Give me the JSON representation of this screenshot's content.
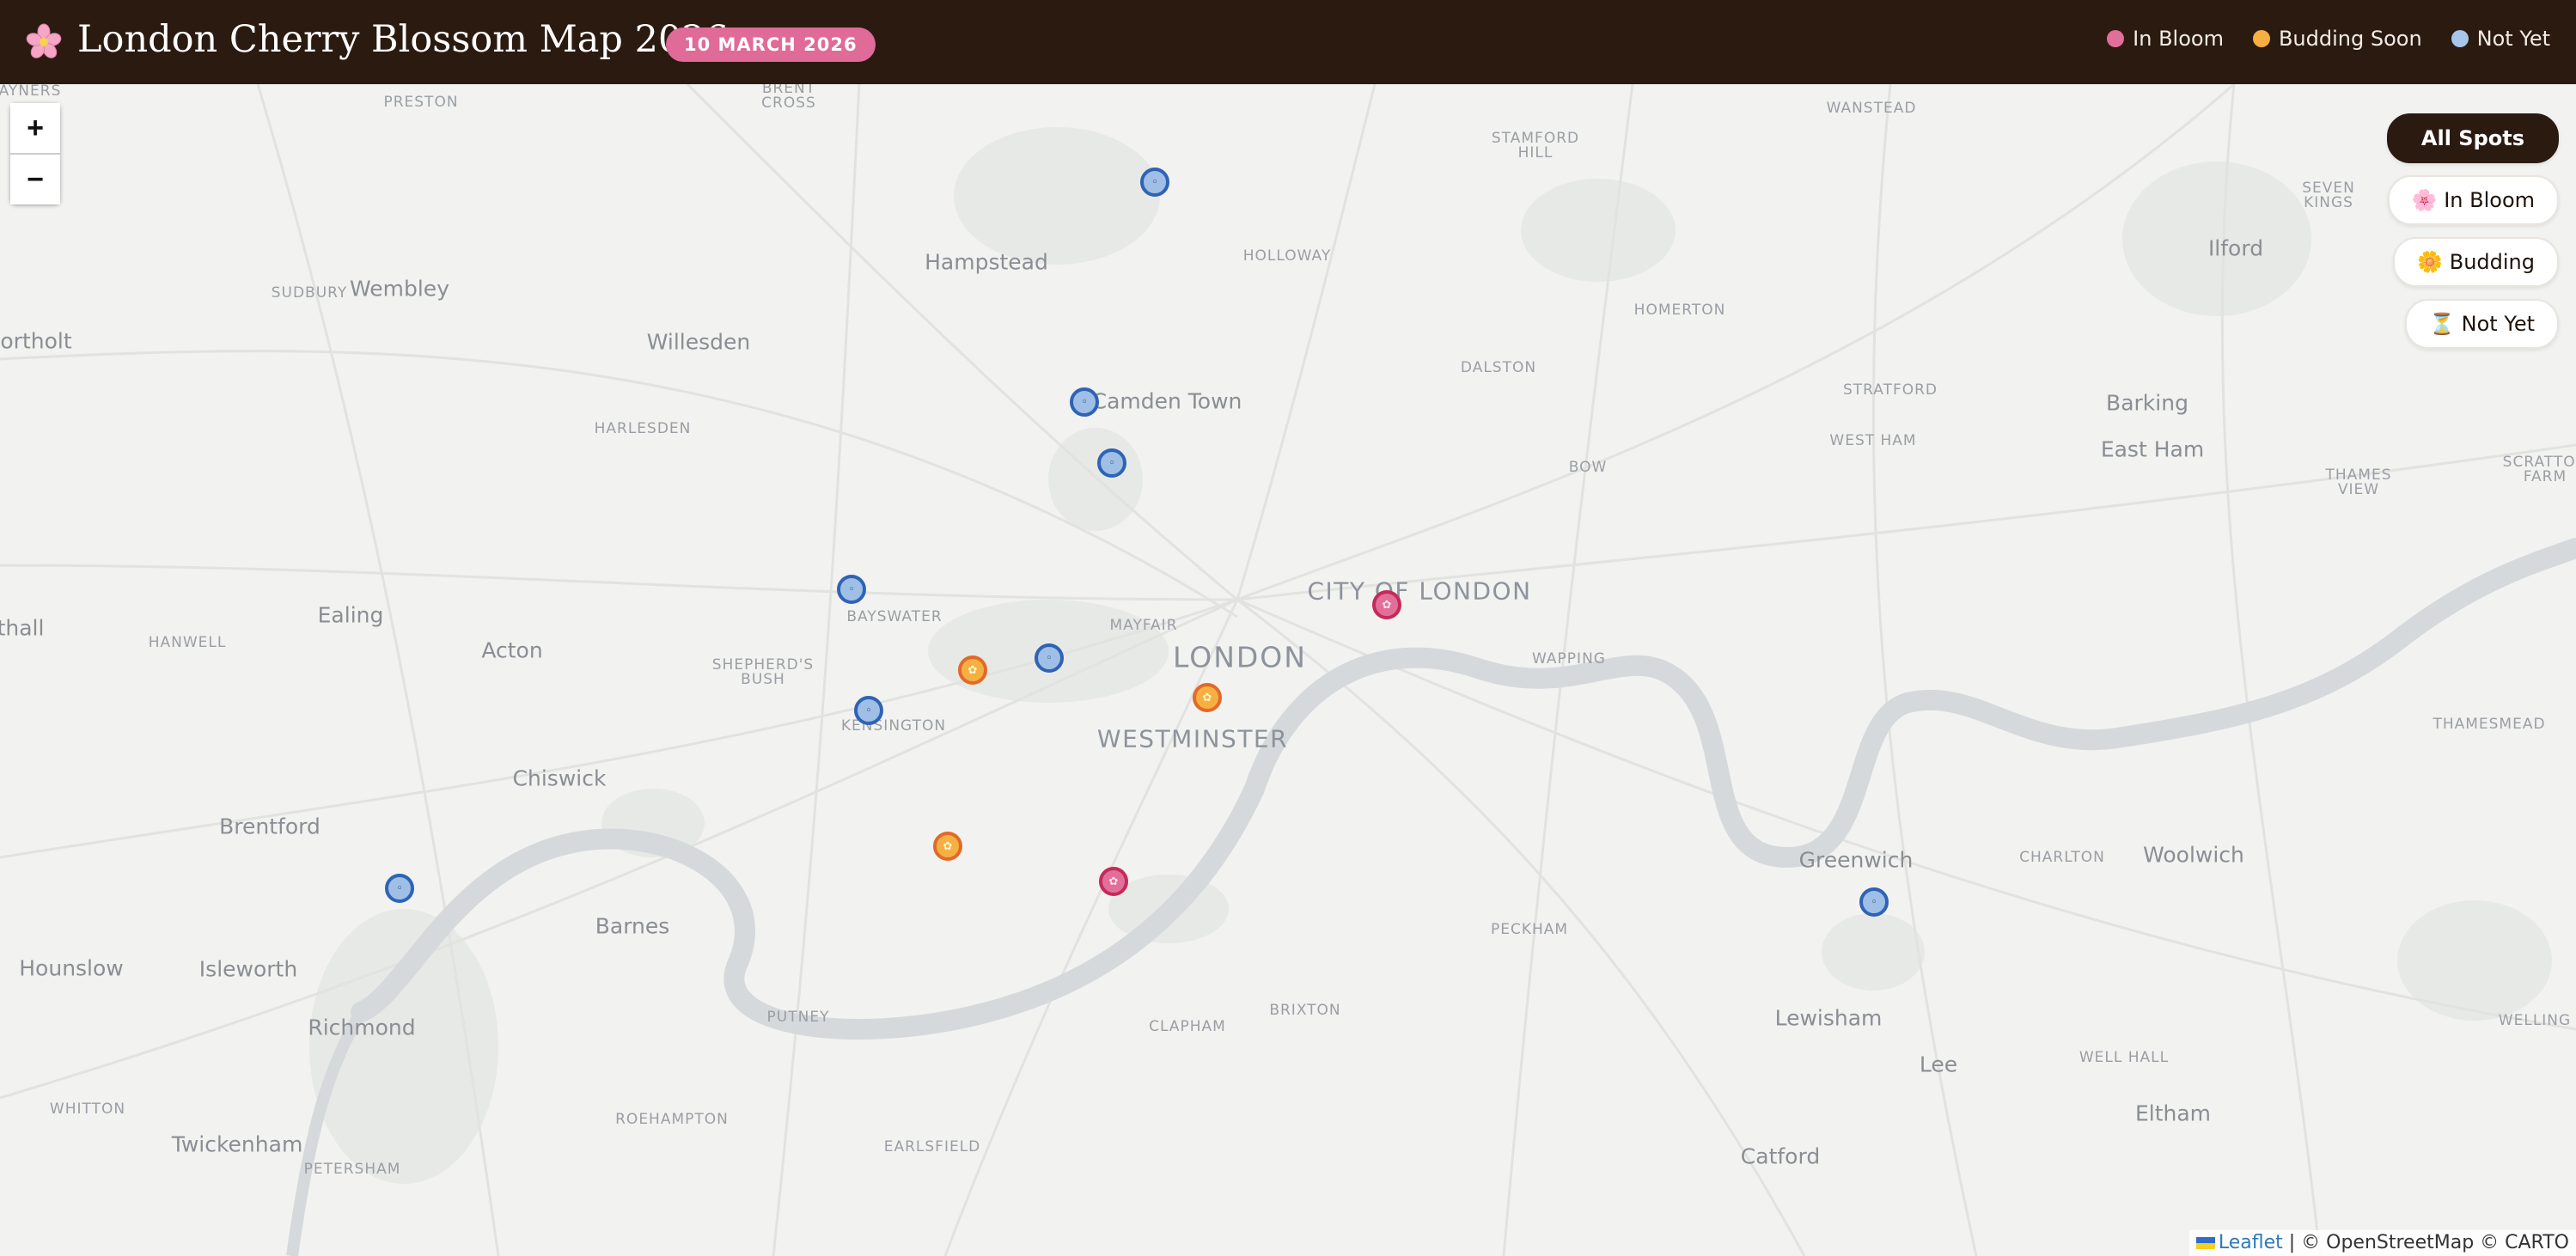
{
  "header": {
    "title": "London Cherry Blossom Map 2026",
    "icon": "cherry-blossom-icon",
    "date_badge": "10 MARCH 2026",
    "legend": [
      {
        "label": "In Bloom",
        "color": "#e16f99"
      },
      {
        "label": "Budding Soon",
        "color": "#f6b042"
      },
      {
        "label": "Not Yet",
        "color": "#a8c6ea"
      }
    ]
  },
  "zoom": {
    "in": "+",
    "out": "−"
  },
  "filters": [
    {
      "label": "All Spots",
      "icon": "",
      "active": true
    },
    {
      "label": "In Bloom",
      "icon": "🌸",
      "active": false
    },
    {
      "label": "Budding",
      "icon": "🌼",
      "active": false
    },
    {
      "label": "Not Yet",
      "icon": "⏳",
      "active": false
    }
  ],
  "places": {
    "preston": "PRESTON",
    "brent_cross": "BRENT\nCROSS",
    "wanstead": "WANSTEAD",
    "stamford_hill": "STAMFORD\nHILL",
    "seven_kings": "SEVEN\nKINGS",
    "hampstead": "Hampstead",
    "holloway": "HOLLOWAY",
    "ilford": "Ilford",
    "sudbury": "SUDBURY",
    "wembley": "Wembley",
    "homerton": "HOMERTON",
    "northolt": "ortholt",
    "willesden": "Willesden",
    "dalston": "DALSTON",
    "camden_town": "Camden Town",
    "stratford": "STRATFORD",
    "barking": "Barking",
    "harlesden": "HARLESDEN",
    "west_ham": "WEST HAM",
    "east_ham": "East Ham",
    "thames_view": "THAMES\nVIEW",
    "scratton_farm": "SCRATTON\nFARM",
    "bow": "BOW",
    "city_of_london": "CITY OF LONDON",
    "ealing": "Ealing",
    "bayswater": "BAYSWATER",
    "hanwell": "HANWELL",
    "acton": "Acton",
    "mayfair": "MAYFAIR",
    "london": "LONDON",
    "wapping": "WAPPING",
    "shepherds_bush": "SHEPHERD'S\nBUSH",
    "hall": "thall",
    "kensington": "KENSINGTON",
    "westminster": "WESTMINSTER",
    "thamesmead": "THAMESMEAD",
    "chiswick": "Chiswick",
    "brentford": "Brentford",
    "greenwich": "Greenwich",
    "charlton": "CHARLTON",
    "woolwich": "Woolwich",
    "barnes": "Barnes",
    "peckham": "PECKHAM",
    "welling": "WELLING",
    "hounslow": "Hounslow",
    "isleworth": "Isleworth",
    "putney": "PUTNEY",
    "brixton": "BRIXTON",
    "clapham": "CLAPHAM",
    "richmond": "Richmond",
    "lewisham": "Lewisham",
    "lee": "Lee",
    "well_hall": "WELL HALL",
    "whitton": "WHITTON",
    "roehampton": "ROEHAMPTON",
    "eltham": "Eltham",
    "twickenham": "Twickenham",
    "earlsfield": "EARLSFIELD",
    "catford": "Catford",
    "petersham": "PETERSHAM",
    "ayners": "AYNERS"
  },
  "markers": [
    {
      "status": "not-yet",
      "icon": "◦"
    },
    {
      "status": "not-yet",
      "icon": "◦"
    },
    {
      "status": "not-yet",
      "icon": "◦"
    },
    {
      "status": "not-yet",
      "icon": "◦"
    },
    {
      "status": "not-yet",
      "icon": "◦"
    },
    {
      "status": "not-yet",
      "icon": "◦"
    },
    {
      "status": "not-yet",
      "icon": "◦"
    },
    {
      "status": "not-yet",
      "icon": "◦"
    },
    {
      "status": "budding",
      "icon": "✿"
    },
    {
      "status": "budding",
      "icon": "✿"
    },
    {
      "status": "budding",
      "icon": "✿"
    },
    {
      "status": "bloom",
      "icon": "✿"
    },
    {
      "status": "bloom",
      "icon": "✿"
    }
  ],
  "attribution": {
    "leaflet": "Leaflet",
    "rest": " | © OpenStreetMap © CARTO"
  }
}
